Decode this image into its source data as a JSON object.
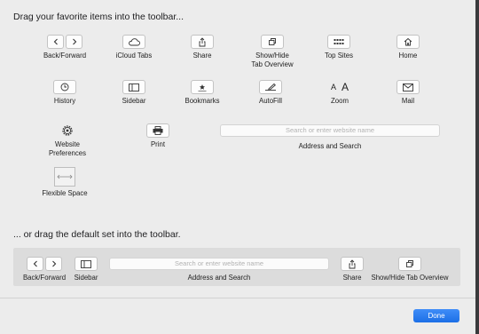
{
  "headings": {
    "favorites": "Drag your favorite items into the toolbar...",
    "default_set": "... or drag the default set into the toolbar."
  },
  "items": {
    "back_forward": "Back/Forward",
    "icloud_tabs": "iCloud Tabs",
    "share": "Share",
    "show_hide_tab_overview": "Show/Hide\nTab Overview",
    "top_sites": "Top Sites",
    "home": "Home",
    "history": "History",
    "sidebar": "Sidebar",
    "bookmarks": "Bookmarks",
    "autofill": "AutoFill",
    "zoom": "Zoom",
    "mail": "Mail",
    "website_preferences": "Website\nPreferences",
    "print": "Print",
    "address_and_search": "Address and Search",
    "flexible_space": "Flexible Space"
  },
  "zoom_glyphs": {
    "small": "A",
    "large": "A"
  },
  "search_placeholder": "Search or enter website name",
  "default_set": {
    "back_forward": "Back/Forward",
    "sidebar": "Sidebar",
    "address_and_search": "Address and Search",
    "share": "Share",
    "show_hide_tab_overview": "Show/Hide Tab Overview"
  },
  "done_label": "Done",
  "colors": {
    "accent": "#1c6fe6",
    "background": "#ececec"
  }
}
